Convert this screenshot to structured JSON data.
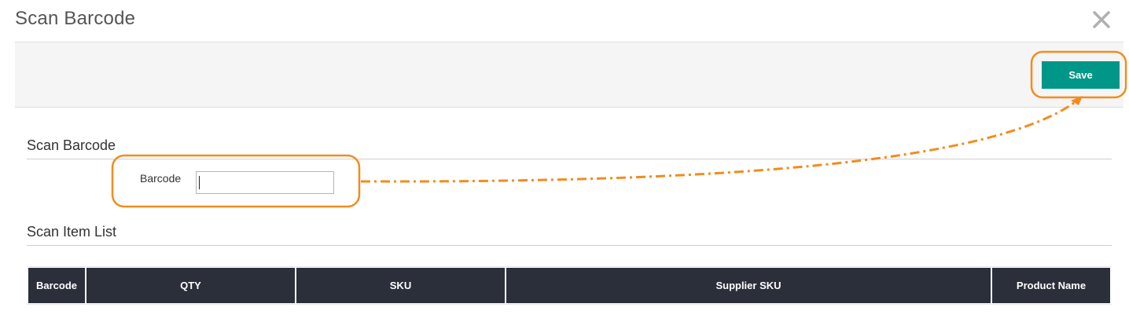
{
  "modal": {
    "title": "Scan Barcode"
  },
  "toolbar": {
    "save_label": "Save"
  },
  "scan_section": {
    "title": "Scan Barcode",
    "barcode_label": "Barcode",
    "barcode_value": "",
    "barcode_placeholder": ""
  },
  "list_section": {
    "title": "Scan Item List",
    "columns": [
      "Barcode",
      "QTY",
      "SKU",
      "Supplier SKU",
      "Product Name"
    ],
    "rows": []
  },
  "icons": {
    "close": "close-icon"
  },
  "colors": {
    "accent": "#009688",
    "table_header": "#2b2f3a",
    "annotation": "#f28c1e"
  }
}
